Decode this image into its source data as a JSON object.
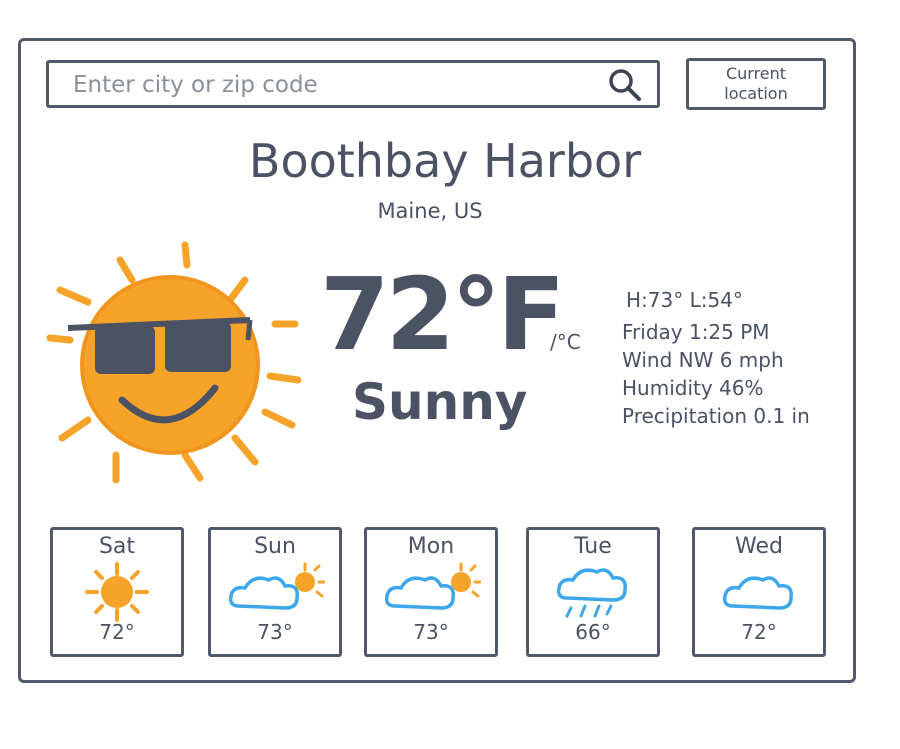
{
  "search": {
    "placeholder": "Enter city or zip code",
    "icon": "search-icon"
  },
  "location_button": {
    "line1": "Current",
    "line2": "location"
  },
  "location": {
    "city": "Boothbay Harbor",
    "region": "Maine, US"
  },
  "current": {
    "temperature": "72°F",
    "unit_toggle": "/°C",
    "condition": "Sunny",
    "icon": "sun-with-sunglasses-icon",
    "high_low": "H:73° L:54°",
    "datetime": "Friday 1:25 PM",
    "wind": "Wind NW 6 mph",
    "humidity": "Humidity 46%",
    "precipitation": "Precipitation 0.1 in"
  },
  "forecast": [
    {
      "day": "Sat",
      "temp": "72°",
      "icon": "sun-icon"
    },
    {
      "day": "Sun",
      "temp": "73°",
      "icon": "partly-cloudy-icon"
    },
    {
      "day": "Mon",
      "temp": "73°",
      "icon": "partly-cloudy-icon"
    },
    {
      "day": "Tue",
      "temp": "66°",
      "icon": "rain-cloud-icon"
    },
    {
      "day": "Wed",
      "temp": "72°",
      "icon": "cloud-icon"
    }
  ],
  "colors": {
    "ink": "#4a5263",
    "sun": "#f6a32a",
    "cloud": "#3ea6ea",
    "shades": "#4a5263"
  }
}
